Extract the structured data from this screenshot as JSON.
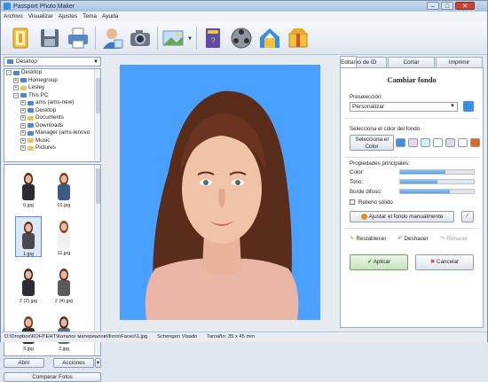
{
  "window": {
    "title": "Passport Photo Maker",
    "min": "–",
    "max": "□",
    "close": "✕"
  },
  "menu": [
    "Archivo",
    "Visualizar",
    "Ajustes",
    "Tema",
    "Ayuda"
  ],
  "toolbar": {
    "icons": [
      "open-icon",
      "save-icon",
      "print-icon",
      "user-icon",
      "camera-icon",
      "enhance-icon",
      "book-icon",
      "video-icon",
      "upload-icon",
      "cart-icon"
    ]
  },
  "browser": {
    "location": "Desktop",
    "tree": [
      {
        "label": "Desktop",
        "level": 0,
        "icon": "blue"
      },
      {
        "label": "Homegroup",
        "level": 1,
        "icon": "blue"
      },
      {
        "label": "Lesley",
        "level": 1,
        "icon": "yellow"
      },
      {
        "label": "This PC",
        "level": 1,
        "icon": "blue"
      },
      {
        "label": "ams (ams-new)",
        "level": 2,
        "icon": "blue"
      },
      {
        "label": "Desktop",
        "level": 2,
        "icon": "blue"
      },
      {
        "label": "Documents",
        "level": 2,
        "icon": "yellow"
      },
      {
        "label": "Downloads",
        "level": 2,
        "icon": "blue"
      },
      {
        "label": "Manager (ams-lenovo",
        "level": 2,
        "icon": "blue"
      },
      {
        "label": "Music",
        "level": 2,
        "icon": "yellow"
      },
      {
        "label": "Pictures",
        "level": 2,
        "icon": "yellow"
      }
    ],
    "thumbs": [
      "0.jpg",
      "01.jpg",
      "1.jpg",
      "11.jpg",
      "2 (2).jpg",
      "2 (4).jpg",
      "3.jpg",
      "3.jpg"
    ],
    "open": "Abrir",
    "actions": "Acciones",
    "compare": "Comparar Fotos"
  },
  "tabs": [
    "Tipo de ID",
    "Cortar",
    "Editar",
    "Imprimir"
  ],
  "panel": {
    "heading": "Cambiar fondo",
    "preselect_label": "Preselección:",
    "preselect_value": "Personalizar",
    "bg_color_label": "Selecciona el color del fondo:",
    "bg_color_button": "Selecciona el Color",
    "swatches": [
      "#3f8fe0",
      "#e7d8f0",
      "#d4eef8",
      "#ffffff",
      "#d9dde3",
      "#ffffff",
      "#e46a12"
    ],
    "props_label": "Propiedades principales:",
    "color_label": "Color:",
    "color_value": 0.62,
    "tono_label": "Tono:",
    "tono_value": 0.5,
    "borde_label": "Borde difuso:",
    "borde_value": 0.68,
    "solid_label": "Relleno sólido",
    "manual_button": "Ajustar el fondo manualmente",
    "reset": "Restablecer",
    "undo": "Deshacer",
    "redo": "Rehacer",
    "apply": "Aplicar",
    "cancel": "Cancelar"
  },
  "status": {
    "path": "D:\\Dropbox\\КОНТЕНТ\\Каталог материалов\\Фото\\Faces\\1.jpg",
    "tool": "Schengen Visado",
    "size": "Tamaño: 35 x 45 mm"
  },
  "colors": {
    "canvas_bg": "#4aa0ff",
    "accent": "#3f8fe0"
  }
}
